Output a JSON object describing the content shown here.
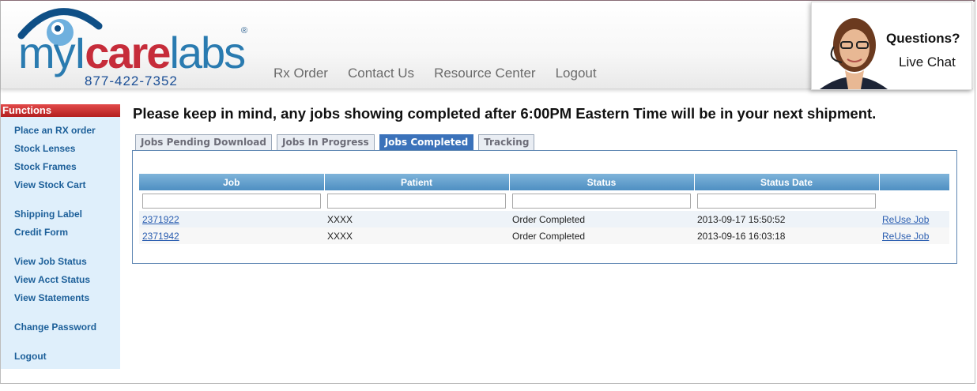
{
  "brand": {
    "my": "my",
    "i": "I",
    "care": "care",
    "labs": "labs",
    "reg": "®",
    "phone": "877-422-7352",
    "colors": {
      "blue": "#2a7bb0",
      "red": "#c62c3a",
      "navy": "#1b4f96"
    }
  },
  "topnav": [
    "Rx Order",
    "Contact Us",
    "Resource Center",
    "Logout"
  ],
  "chat": {
    "question": "Questions?",
    "live": "Live Chat"
  },
  "sidebar": {
    "heading": "Functions",
    "items": [
      "Place an RX order",
      "Stock Lenses",
      "Stock Frames",
      "View Stock Cart",
      "Shipping Label",
      "Credit Form",
      "View Job Status",
      "View Acct Status",
      "View Statements",
      "Change Password",
      "Logout"
    ]
  },
  "notice": "Please keep in mind, any jobs showing completed after 6:00PM Eastern Time will be in your next shipment.",
  "tabs": [
    {
      "label": "Jobs Pending Download",
      "active": false
    },
    {
      "label": "Jobs In Progress",
      "active": false
    },
    {
      "label": "Jobs Completed",
      "active": true
    },
    {
      "label": "Tracking",
      "active": false
    }
  ],
  "table": {
    "headers": [
      "Job",
      "Patient",
      "Status",
      "Status Date",
      ""
    ],
    "rows": [
      {
        "job": "2371922",
        "patient": "XXXX",
        "status": "Order Completed",
        "date": "2013-09-17 15:50:52",
        "action": "ReUse Job"
      },
      {
        "job": "2371942",
        "patient": "XXXX",
        "status": "Order Completed",
        "date": "2013-09-16 16:03:18",
        "action": "ReUse Job"
      }
    ]
  }
}
